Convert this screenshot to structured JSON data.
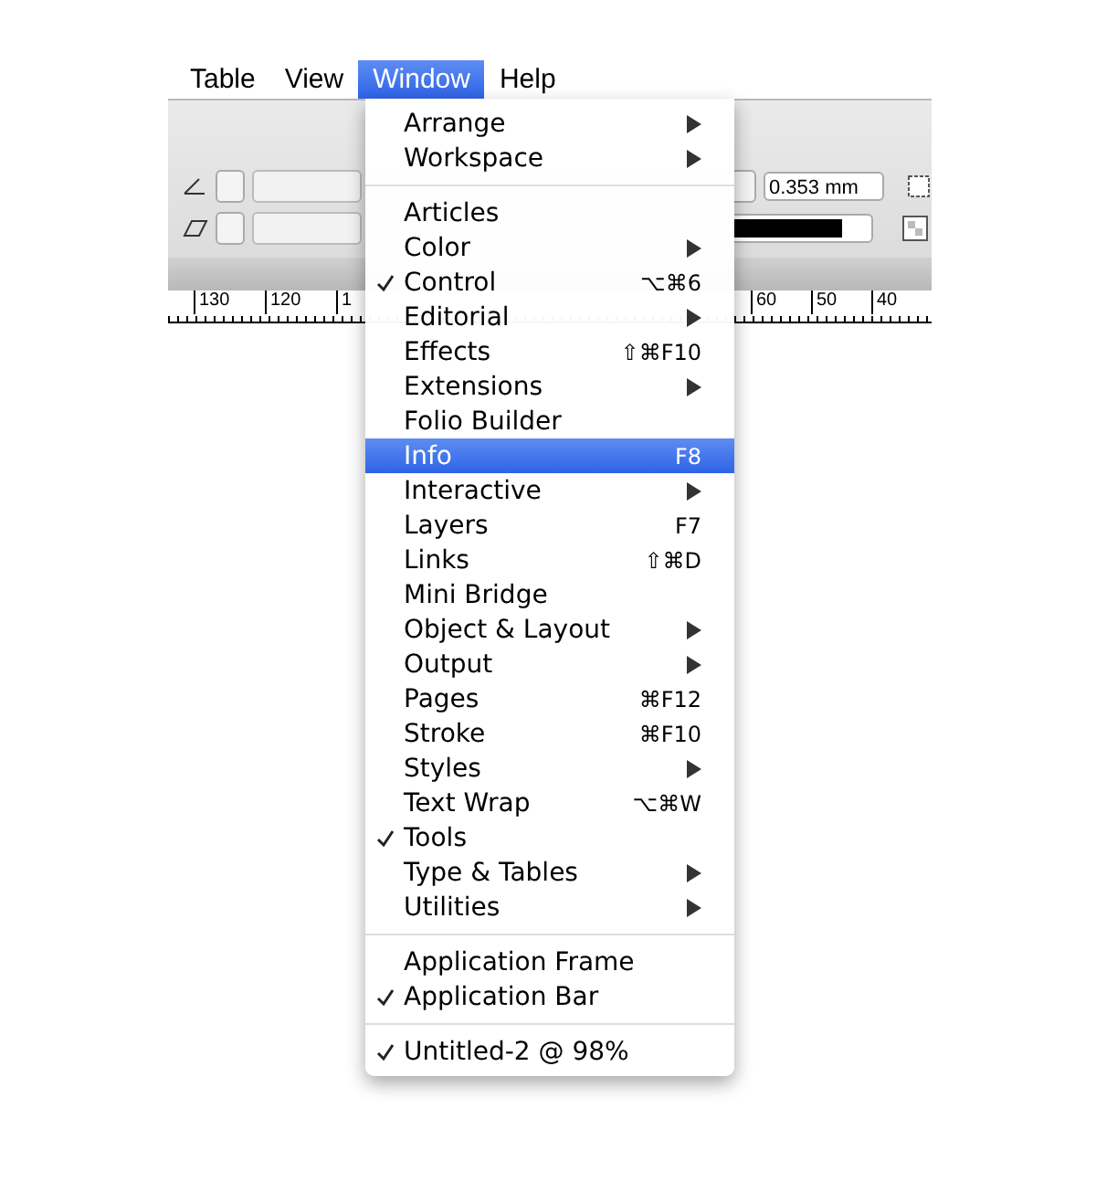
{
  "menubar": [
    {
      "label": "Table",
      "selected": false
    },
    {
      "label": "View",
      "selected": false
    },
    {
      "label": "Window",
      "selected": true
    },
    {
      "label": "Help",
      "selected": false
    }
  ],
  "control_panel": {
    "stroke_weight": "0.353 mm"
  },
  "ruler": {
    "left_labels": [
      "130",
      "120",
      "1"
    ],
    "right_labels": [
      "60",
      "50",
      "40"
    ]
  },
  "menu": {
    "sections": [
      {
        "items": [
          {
            "label": "Arrange",
            "checked": false,
            "submenu": true,
            "selected": false
          },
          {
            "label": "Workspace",
            "checked": false,
            "submenu": true,
            "selected": false
          }
        ]
      },
      {
        "items": [
          {
            "label": "Articles",
            "checked": false,
            "submenu": false,
            "selected": false
          },
          {
            "label": "Color",
            "checked": false,
            "submenu": true,
            "selected": false
          },
          {
            "label": "Control",
            "checked": true,
            "submenu": false,
            "shortcut": "⌥⌘6",
            "selected": false
          },
          {
            "label": "Editorial",
            "checked": false,
            "submenu": true,
            "selected": false
          },
          {
            "label": "Effects",
            "checked": false,
            "submenu": false,
            "shortcut": "⇧⌘F10",
            "selected": false
          },
          {
            "label": "Extensions",
            "checked": false,
            "submenu": true,
            "selected": false
          },
          {
            "label": "Folio Builder",
            "checked": false,
            "submenu": false,
            "selected": false
          },
          {
            "label": "Info",
            "checked": false,
            "submenu": false,
            "shortcut": "F8",
            "selected": true
          },
          {
            "label": "Interactive",
            "checked": false,
            "submenu": true,
            "selected": false
          },
          {
            "label": "Layers",
            "checked": false,
            "submenu": false,
            "shortcut": "F7",
            "selected": false
          },
          {
            "label": "Links",
            "checked": false,
            "submenu": false,
            "shortcut": "⇧⌘D",
            "selected": false
          },
          {
            "label": "Mini Bridge",
            "checked": false,
            "submenu": false,
            "selected": false
          },
          {
            "label": "Object & Layout",
            "checked": false,
            "submenu": true,
            "selected": false
          },
          {
            "label": "Output",
            "checked": false,
            "submenu": true,
            "selected": false
          },
          {
            "label": "Pages",
            "checked": false,
            "submenu": false,
            "shortcut": "⌘F12",
            "selected": false
          },
          {
            "label": "Stroke",
            "checked": false,
            "submenu": false,
            "shortcut": "⌘F10",
            "selected": false
          },
          {
            "label": "Styles",
            "checked": false,
            "submenu": true,
            "selected": false
          },
          {
            "label": "Text Wrap",
            "checked": false,
            "submenu": false,
            "shortcut": "⌥⌘W",
            "selected": false
          },
          {
            "label": "Tools",
            "checked": true,
            "submenu": false,
            "selected": false
          },
          {
            "label": "Type & Tables",
            "checked": false,
            "submenu": true,
            "selected": false
          },
          {
            "label": "Utilities",
            "checked": false,
            "submenu": true,
            "selected": false
          }
        ]
      },
      {
        "items": [
          {
            "label": "Application Frame",
            "checked": false,
            "submenu": false,
            "selected": false
          },
          {
            "label": "Application Bar",
            "checked": true,
            "submenu": false,
            "selected": false
          }
        ]
      },
      {
        "items": [
          {
            "label": "Untitled-2 @ 98%",
            "checked": true,
            "submenu": false,
            "selected": false
          }
        ]
      }
    ]
  }
}
